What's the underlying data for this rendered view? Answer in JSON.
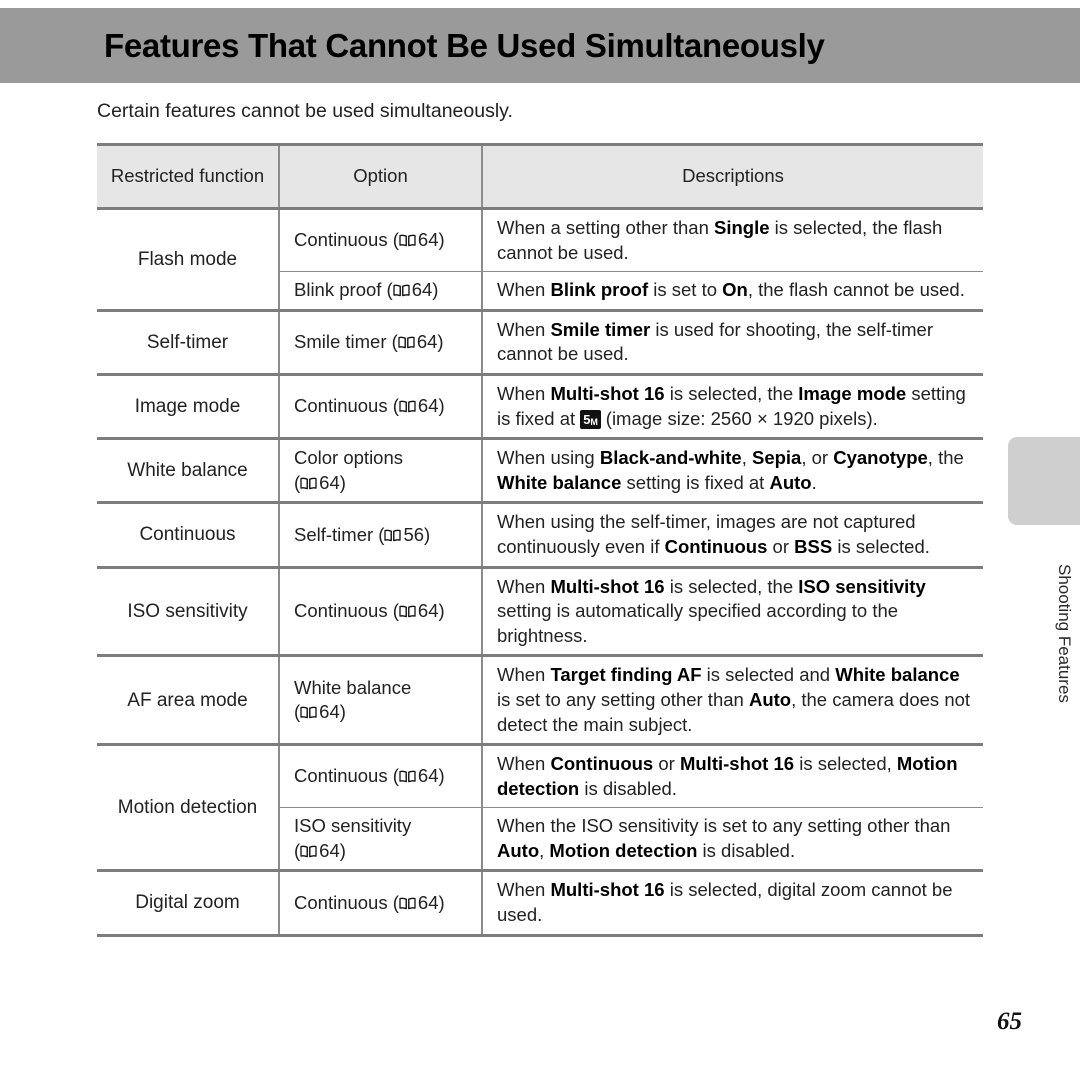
{
  "page": {
    "title": "Features That Cannot Be Used Simultaneously",
    "intro": "Certain features cannot be used simultaneously.",
    "page_number": "65",
    "side_tab_label": "Shooting Features",
    "banner_color": "#9a9a9a",
    "header_fill": "#e6e6e6",
    "rule_color": "#7d7d7d"
  },
  "table": {
    "headers": {
      "function": "Restricted function",
      "option": "Option",
      "description": "Descriptions"
    },
    "rows": [
      {
        "function": "Flash mode",
        "subrows": [
          {
            "option_label": "Continuous",
            "option_page": "64",
            "desc_parts": [
              {
                "t": "When a setting other than ",
                "b": false
              },
              {
                "t": "Single",
                "b": true
              },
              {
                "t": " is selected, the flash cannot be used.",
                "b": false
              }
            ]
          },
          {
            "option_label": "Blink proof",
            "option_page": "64",
            "desc_parts": [
              {
                "t": "When ",
                "b": false
              },
              {
                "t": "Blink proof",
                "b": true
              },
              {
                "t": " is set to ",
                "b": false
              },
              {
                "t": "On",
                "b": true
              },
              {
                "t": ", the flash cannot be used.",
                "b": false
              }
            ]
          }
        ]
      },
      {
        "function": "Self-timer",
        "subrows": [
          {
            "option_label": "Smile timer",
            "option_page": "64",
            "desc_parts": [
              {
                "t": "When ",
                "b": false
              },
              {
                "t": "Smile timer",
                "b": true
              },
              {
                "t": " is used for shooting, the self-timer cannot be used.",
                "b": false
              }
            ]
          }
        ]
      },
      {
        "function": "Image mode",
        "subrows": [
          {
            "option_label": "Continuous",
            "option_page": "64",
            "desc_parts": [
              {
                "t": "When ",
                "b": false
              },
              {
                "t": "Multi-shot 16",
                "b": true
              },
              {
                "t": " is selected, the ",
                "b": false
              },
              {
                "t": "Image mode",
                "b": true
              },
              {
                "t": " setting is fixed at ",
                "b": false
              },
              {
                "badge": "5",
                "badge_sub": "M"
              },
              {
                "t": " (image size: 2560 × 1920 pixels).",
                "b": false
              }
            ]
          }
        ]
      },
      {
        "function": "White balance",
        "subrows": [
          {
            "option_label": "Color options",
            "option_page": "64",
            "option_wrap": true,
            "desc_parts": [
              {
                "t": "When using ",
                "b": false
              },
              {
                "t": "Black-and-white",
                "b": true
              },
              {
                "t": ", ",
                "b": false
              },
              {
                "t": "Sepia",
                "b": true
              },
              {
                "t": ", or ",
                "b": false
              },
              {
                "t": "Cyanotype",
                "b": true
              },
              {
                "t": ", the ",
                "b": false
              },
              {
                "t": "White balance",
                "b": true
              },
              {
                "t": " setting is fixed at ",
                "b": false
              },
              {
                "t": "Auto",
                "b": true
              },
              {
                "t": ".",
                "b": false
              }
            ]
          }
        ]
      },
      {
        "function": "Continuous",
        "subrows": [
          {
            "option_label": "Self-timer",
            "option_page": "56",
            "desc_parts": [
              {
                "t": "When using the self-timer, images are not captured continuously even if ",
                "b": false
              },
              {
                "t": "Continuous",
                "b": true
              },
              {
                "t": " or ",
                "b": false
              },
              {
                "t": "BSS",
                "b": true
              },
              {
                "t": " is selected.",
                "b": false
              }
            ]
          }
        ]
      },
      {
        "function": "ISO sensitivity",
        "subrows": [
          {
            "option_label": "Continuous",
            "option_page": "64",
            "desc_parts": [
              {
                "t": "When ",
                "b": false
              },
              {
                "t": "Multi-shot 16",
                "b": true
              },
              {
                "t": " is selected, the ",
                "b": false
              },
              {
                "t": "ISO sensitivity",
                "b": true
              },
              {
                "t": " setting is automatically specified according to the brightness.",
                "b": false
              }
            ]
          }
        ]
      },
      {
        "function": "AF area mode",
        "subrows": [
          {
            "option_label": "White balance",
            "option_page": "64",
            "option_wrap": true,
            "desc_parts": [
              {
                "t": "When ",
                "b": false
              },
              {
                "t": "Target finding AF",
                "b": true
              },
              {
                "t": " is selected and ",
                "b": false
              },
              {
                "t": "White balance",
                "b": true
              },
              {
                "t": " is set to any setting other than ",
                "b": false
              },
              {
                "t": "Auto",
                "b": true
              },
              {
                "t": ", the camera does not detect the main subject.",
                "b": false
              }
            ]
          }
        ]
      },
      {
        "function": "Motion detection",
        "subrows": [
          {
            "option_label": "Continuous",
            "option_page": "64",
            "desc_parts": [
              {
                "t": "When ",
                "b": false
              },
              {
                "t": "Continuous",
                "b": true
              },
              {
                "t": " or ",
                "b": false
              },
              {
                "t": "Multi-shot 16",
                "b": true
              },
              {
                "t": " is selected, ",
                "b": false
              },
              {
                "t": "Motion detection",
                "b": true
              },
              {
                "t": " is disabled.",
                "b": false
              }
            ]
          },
          {
            "option_label": "ISO sensitivity",
            "option_page": "64",
            "option_wrap": true,
            "desc_parts": [
              {
                "t": "When the ISO sensitivity is set to any setting other than ",
                "b": false
              },
              {
                "t": "Auto",
                "b": true
              },
              {
                "t": ", ",
                "b": false
              },
              {
                "t": "Motion detection",
                "b": true
              },
              {
                "t": " is disabled.",
                "b": false
              }
            ]
          }
        ]
      },
      {
        "function": "Digital zoom",
        "subrows": [
          {
            "option_label": "Continuous",
            "option_page": "64",
            "desc_parts": [
              {
                "t": "When ",
                "b": false
              },
              {
                "t": "Multi-shot 16",
                "b": true
              },
              {
                "t": " is selected, digital zoom cannot be used.",
                "b": false
              }
            ]
          }
        ]
      }
    ]
  }
}
